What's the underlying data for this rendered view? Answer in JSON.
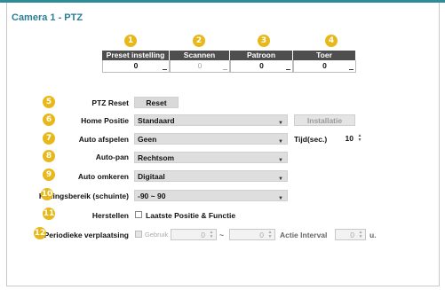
{
  "title": "Camera 1 - PTZ",
  "callouts": [
    "1",
    "2",
    "3",
    "4",
    "5",
    "6",
    "7",
    "8",
    "9",
    "10",
    "11",
    "12"
  ],
  "table": {
    "headers": [
      "Preset instelling",
      "Scannen",
      "Patroon",
      "Toer"
    ],
    "values": [
      "0",
      "0",
      "0",
      "0"
    ]
  },
  "ptz_reset": {
    "label": "PTZ Reset",
    "button": "Reset"
  },
  "home_position": {
    "label": "Home Positie",
    "value": "Standaard",
    "button": "Installatie"
  },
  "auto_play": {
    "label": "Auto afspelen",
    "value": "Geen",
    "time_label": "Tijd(sec.)",
    "time_value": "10"
  },
  "auto_pan": {
    "label": "Auto-pan",
    "value": "Rechtsom"
  },
  "auto_flip": {
    "label": "Auto omkeren",
    "value": "Digitaal"
  },
  "tilt_range": {
    "label": "Hellingsbereik (schuinte)",
    "value": "-90 ~ 90"
  },
  "restore": {
    "label": "Herstellen",
    "checkbox_label": "Laatste Positie & Functie"
  },
  "periodic": {
    "label": "Periodieke verplaatsing",
    "use_label": "Gebruik",
    "from_value": "0",
    "tilde": "~",
    "to_value": "0",
    "interval_label": "Actie Interval",
    "interval_value": "0",
    "unit": "u."
  },
  "colors": {
    "accent": "#2a7e96",
    "callout": "#e8b81a",
    "header_bg": "#4e4e4e"
  }
}
